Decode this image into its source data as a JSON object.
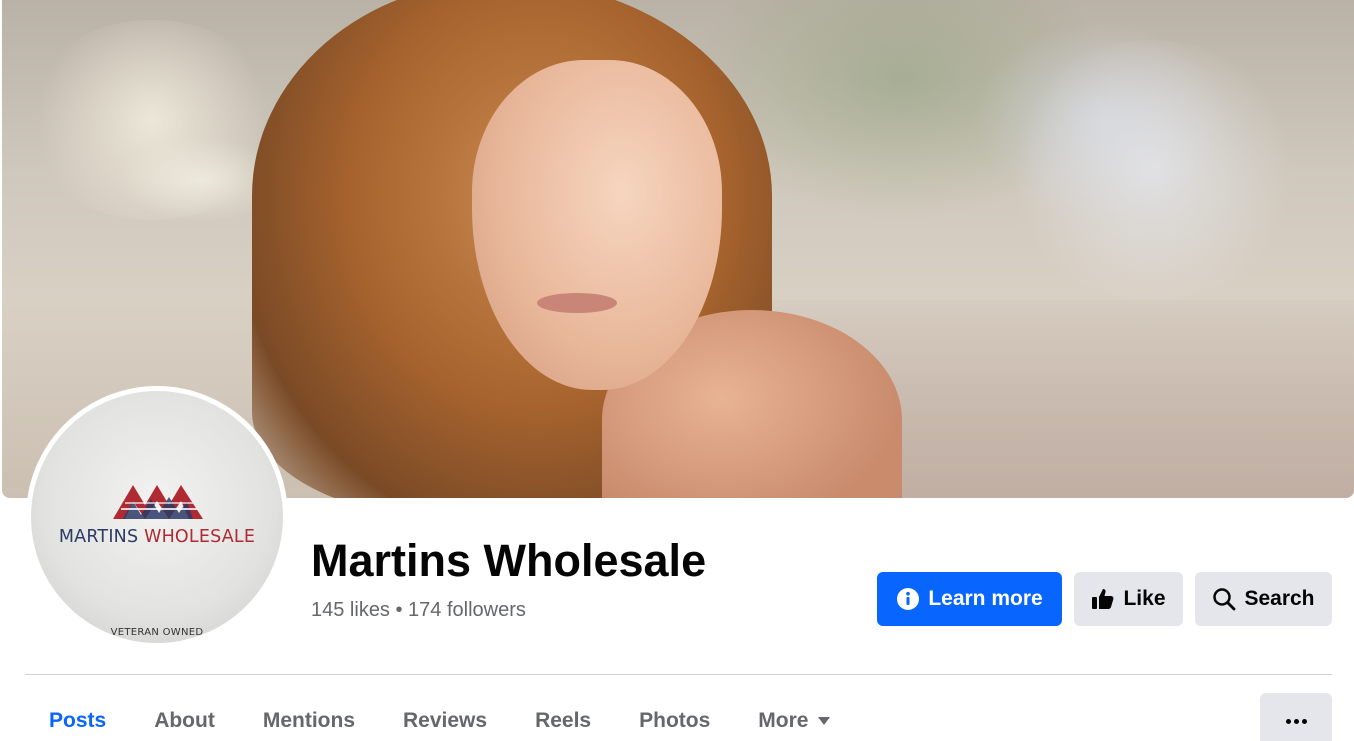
{
  "page": {
    "name": "Martins Wholesale",
    "stats": "145 likes • 174 followers"
  },
  "avatar": {
    "logo_word1": "MARTINS",
    "logo_word2": "WHOLESALE",
    "tagline": "VETERAN OWNED"
  },
  "actions": {
    "learn_more": "Learn more",
    "like": "Like",
    "search": "Search"
  },
  "tabs": [
    {
      "label": "Posts",
      "active": true
    },
    {
      "label": "About"
    },
    {
      "label": "Mentions"
    },
    {
      "label": "Reviews"
    },
    {
      "label": "Reels"
    },
    {
      "label": "Photos"
    },
    {
      "label": "More"
    }
  ],
  "colors": {
    "primary": "#0866ff",
    "button_gray": "#e4e6eb",
    "text_secondary": "#65676b",
    "logo_blue": "#2c3a66",
    "logo_red": "#b02a33"
  },
  "icons": {
    "learn_more": "info-circle-icon",
    "like": "thumbs-up-icon",
    "search": "magnifier-icon",
    "more_tab": "caret-down-icon",
    "overflow": "ellipsis-icon"
  }
}
